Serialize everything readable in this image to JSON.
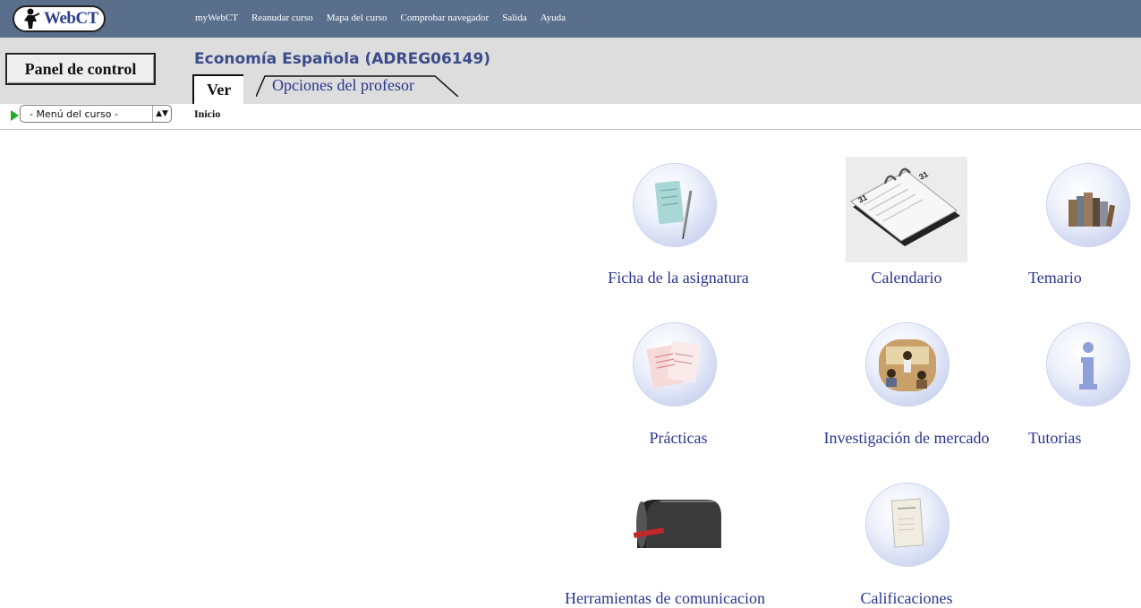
{
  "logo": {
    "text": "WebCT"
  },
  "topnav": [
    {
      "label": "myWebCT"
    },
    {
      "label": "Reanudar curso"
    },
    {
      "label": "Mapa del curso"
    },
    {
      "label": "Comprobar navegador"
    },
    {
      "label": "Salida"
    },
    {
      "label": "Ayuda"
    }
  ],
  "header": {
    "panel_button": "Panel de control",
    "course_title": "Economía Española  (ADREG06149)",
    "tabs": [
      {
        "label": "Ver",
        "active": true
      },
      {
        "label": "Opciones del profesor",
        "active": false
      }
    ]
  },
  "subbar": {
    "menu_select": "- Menú del curso -",
    "breadcrumb": "Inicio"
  },
  "tools": [
    {
      "label": "Ficha de la asignatura",
      "icon": "document-pen-icon"
    },
    {
      "label": "Calendario",
      "icon": "desk-calendar-icon"
    },
    {
      "label": "Temario",
      "icon": "books-icon"
    },
    {
      "label": "Prácticas",
      "icon": "papers-icon"
    },
    {
      "label": "Investigación de mercado",
      "icon": "meeting-photo-icon"
    },
    {
      "label": "Tutorias",
      "icon": "info-icon"
    },
    {
      "label": "Herramientas de comunicacion",
      "icon": "mailbox-icon"
    },
    {
      "label": "Calificaciones",
      "icon": "report-card-icon"
    }
  ],
  "colors": {
    "topbar": "#5a6f8c",
    "header": "#dddddd",
    "link": "#2a3590",
    "title": "#3b4c8c"
  }
}
